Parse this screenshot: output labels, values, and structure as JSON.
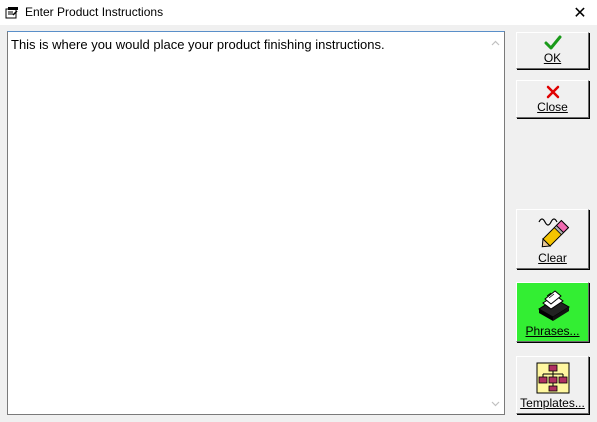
{
  "window": {
    "title": "Enter Product Instructions",
    "close_glyph": "✕"
  },
  "editor": {
    "text": "This is where you would place your product finishing instructions."
  },
  "buttons": {
    "ok": {
      "label": "OK",
      "icon": "green-checkmark-icon"
    },
    "close": {
      "label": "Close",
      "icon": "red-x-icon"
    },
    "clear": {
      "label": "Clear",
      "icon": "eraser-pencil-icon"
    },
    "phrases": {
      "label": "Phrases...",
      "icon": "card-file-icon",
      "background": "#33ee33"
    },
    "templates": {
      "label": "Templates...",
      "icon": "hierarchy-chart-icon"
    }
  },
  "colors": {
    "window_bg": "#f0f0f0",
    "editor_border_focus": "#5a8fc9",
    "phrases_bg": "#33ee33",
    "ok_icon": "#1a9a1a",
    "close_icon": "#e00000"
  }
}
